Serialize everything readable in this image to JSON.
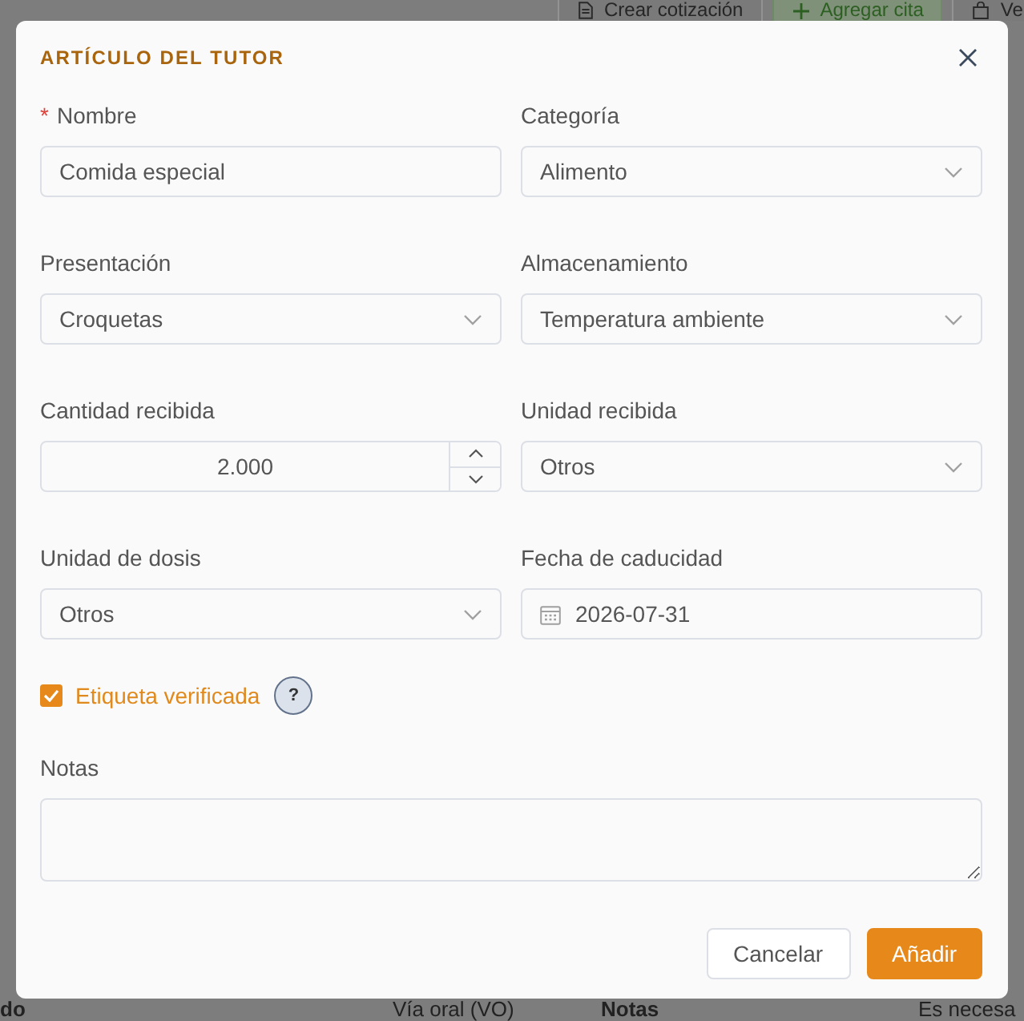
{
  "page": {
    "toolbar": [
      {
        "label": "Crear cotización",
        "kind": "document"
      },
      {
        "label": "Agregar cita",
        "kind": "add"
      },
      {
        "label": "Ve",
        "kind": "bag"
      }
    ],
    "row": [
      {
        "text": "do",
        "kind": "label"
      },
      {
        "text": "Vía oral (VO)",
        "kind": "value"
      },
      {
        "text": "Notas",
        "kind": "label"
      },
      {
        "text": "Es necesa",
        "kind": "value"
      }
    ]
  },
  "dialog": {
    "title": "ARTÍCULO DEL TUTOR",
    "required_mark": "*",
    "fields": [
      {
        "kind": "text",
        "label": "Nombre",
        "required": true,
        "value": "Comida especial"
      },
      {
        "kind": "select",
        "label": "Categoría",
        "required": false,
        "value": "Alimento"
      },
      {
        "kind": "select",
        "label": "Presentación",
        "required": false,
        "value": "Croquetas"
      },
      {
        "kind": "select",
        "label": "Almacenamiento",
        "required": false,
        "value": "Temperatura ambiente"
      },
      {
        "kind": "number",
        "label": "Cantidad recibida",
        "required": false,
        "value": "2.000"
      },
      {
        "kind": "select",
        "label": "Unidad recibida",
        "required": false,
        "value": "Otros"
      },
      {
        "kind": "select",
        "label": "Unidad de dosis",
        "required": false,
        "value": "Otros"
      },
      {
        "kind": "date",
        "label": "Fecha de caducidad",
        "required": false,
        "value": "2026-07-31"
      }
    ],
    "verified": {
      "label": "Etiqueta verificada",
      "checked": true,
      "help": "?"
    },
    "notes": {
      "label": "Notas"
    },
    "buttons": [
      {
        "label": "Cancelar",
        "kind": "secondary"
      },
      {
        "label": "Añadir",
        "kind": "primary"
      }
    ]
  }
}
